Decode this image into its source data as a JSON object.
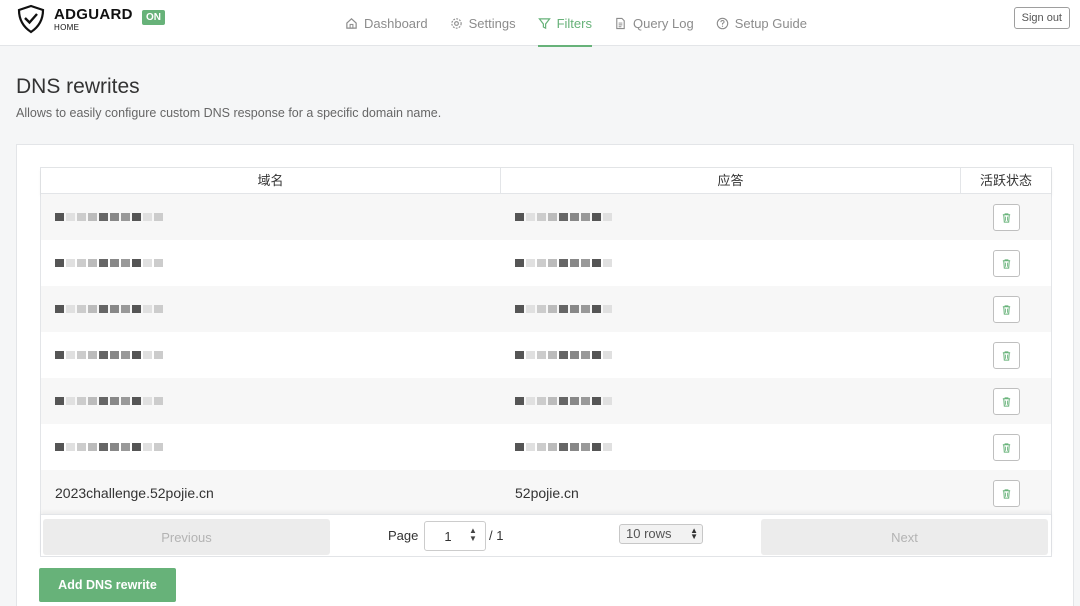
{
  "header": {
    "logo_main": "ADGUARD",
    "logo_sub": "HOME",
    "status_badge": "ON",
    "nav": [
      {
        "label": "Dashboard",
        "icon": "home-icon"
      },
      {
        "label": "Settings",
        "icon": "gear-icon"
      },
      {
        "label": "Filters",
        "icon": "filter-icon",
        "active": true
      },
      {
        "label": "Query Log",
        "icon": "document-icon"
      },
      {
        "label": "Setup Guide",
        "icon": "help-circle-icon"
      }
    ],
    "signout": "Sign out"
  },
  "page": {
    "title": "DNS rewrites",
    "description": "Allows to easily configure custom DNS response for a specific domain name."
  },
  "table": {
    "columns": [
      "域名",
      "应答",
      "活跃状态"
    ],
    "rows": [
      {
        "domain": "",
        "answer": ""
      },
      {
        "domain": "",
        "answer": ""
      },
      {
        "domain": "",
        "answer": ""
      },
      {
        "domain": "",
        "answer": ""
      },
      {
        "domain": "",
        "answer": ""
      },
      {
        "domain": "",
        "answer": ""
      },
      {
        "domain": "2023challenge.52pojie.cn",
        "answer": "52pojie.cn"
      }
    ]
  },
  "pagination": {
    "previous": "Previous",
    "page_label": "Page",
    "page_value": "1",
    "page_total": "/ 1",
    "rows_select": "10 rows",
    "next": "Next"
  },
  "actions": {
    "add_button": "Add DNS rewrite"
  },
  "colors": {
    "accent": "#67b279",
    "page_bg": "#f5f6f7"
  }
}
